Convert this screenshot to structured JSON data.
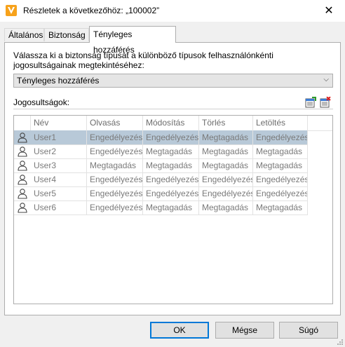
{
  "window": {
    "title": "Részletek a következőhöz: „100002”",
    "close_label": "✕"
  },
  "tabs": [
    {
      "label": "Általános"
    },
    {
      "label": "Biztonság"
    },
    {
      "label": "Tényleges hozzáférés"
    }
  ],
  "panel": {
    "description": "Válassza ki a biztonság típusát a különböző típusok felhasználónkénti jogosultságainak megtekintéséhez:",
    "select_value": "Tényleges hozzáférés",
    "permissions_label": "Jogosultságok:"
  },
  "grid": {
    "columns": [
      "Név",
      "Olvasás",
      "Módosítás",
      "Törlés",
      "Letöltés"
    ],
    "rows": [
      {
        "name": "User1",
        "read": "Engedélyezés",
        "modify": "Engedélyezés",
        "delete": "Megtagadás",
        "download": "Engedélyezés",
        "selected": true
      },
      {
        "name": "User2",
        "read": "Engedélyezés",
        "modify": "Megtagadás",
        "delete": "Megtagadás",
        "download": "Megtagadás"
      },
      {
        "name": "User3",
        "read": "Megtagadás",
        "modify": "Megtagadás",
        "delete": "Megtagadás",
        "download": "Megtagadás"
      },
      {
        "name": "User4",
        "read": "Engedélyezés",
        "modify": "Engedélyezés",
        "delete": "Engedélyezés",
        "download": "Engedélyezés"
      },
      {
        "name": "User5",
        "read": "Engedélyezés",
        "modify": "Engedélyezés",
        "delete": "Engedélyezés",
        "download": "Engedélyezés"
      },
      {
        "name": "User6",
        "read": "Engedélyezés",
        "modify": "Megtagadás",
        "delete": "Megtagadás",
        "download": "Megtagadás"
      }
    ]
  },
  "buttons": {
    "ok": "OK",
    "cancel": "Mégse",
    "help": "Súgó"
  },
  "colors": {
    "selected_row": "#b8c9d8",
    "app_icon": "#f7a21b",
    "default_button_border": "#0078d7"
  }
}
